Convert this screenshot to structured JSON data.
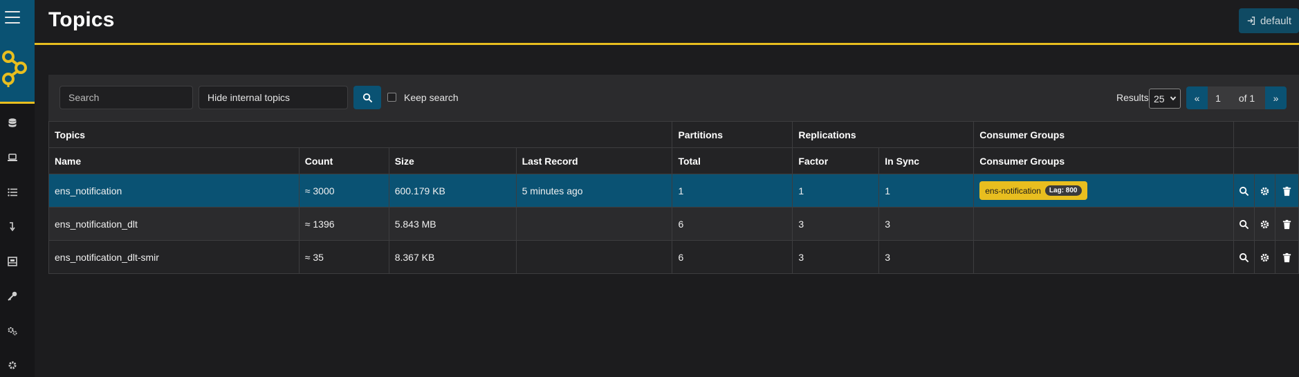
{
  "header": {
    "title": "Topics",
    "login_label": "default"
  },
  "toolbar": {
    "search_placeholder": "Search",
    "filter_value": "Hide internal topics",
    "keep_search_label": "Keep search",
    "results_label": "Results",
    "results_per_page": "25",
    "pager": {
      "first": "«",
      "current": "1",
      "of": "of 1",
      "last": "»"
    }
  },
  "table": {
    "group_headers": [
      "Topics",
      "Partitions",
      "Replications",
      "Consumer Groups"
    ],
    "columns": [
      "Name",
      "Count",
      "Size",
      "Last Record",
      "Total",
      "Factor",
      "In Sync",
      "Consumer Groups"
    ],
    "rows": [
      {
        "name": "ens_notification",
        "count": "≈ 3000",
        "size": "600.179 KB",
        "last_record": "5 minutes ago",
        "total": "1",
        "factor": "1",
        "in_sync": "1",
        "consumer_group": "ens-notification",
        "lag": "Lag: 800"
      },
      {
        "name": "ens_notification_dlt",
        "count": "≈ 1396",
        "size": "5.843 MB",
        "last_record": "",
        "total": "6",
        "factor": "3",
        "in_sync": "3",
        "consumer_group": "",
        "lag": ""
      },
      {
        "name": "ens_notification_dlt-smir",
        "count": "≈ 35",
        "size": "8.367 KB",
        "last_record": "",
        "total": "6",
        "factor": "3",
        "in_sync": "3",
        "consumer_group": "",
        "lag": ""
      }
    ]
  },
  "sidebar": {
    "items": [
      "database-icon",
      "laptop-icon",
      "list-icon",
      "level-down-icon",
      "schema-icon",
      "key-icon",
      "cogs-icon",
      "settings-icon"
    ]
  },
  "colors": {
    "accent": "#e8be1f",
    "primary": "#0a5273",
    "background": "#1c1c1e"
  }
}
